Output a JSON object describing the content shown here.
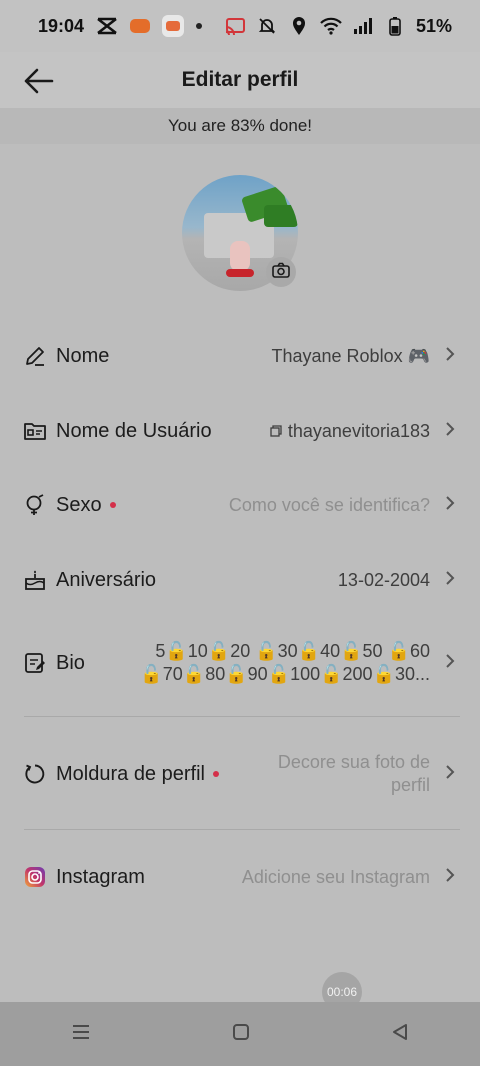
{
  "status_bar": {
    "time": "19:04",
    "battery": "51%",
    "icons": [
      "capcut-icon",
      "notification-app-icon",
      "game-app-icon",
      "dot-icon",
      "cast-icon",
      "mute-icon",
      "location-icon",
      "wifi-icon",
      "signal-icon",
      "battery-icon"
    ]
  },
  "header": {
    "title": "Editar perfil",
    "back_icon": "arrow-left-icon"
  },
  "progress_text": "You are 83% done!",
  "profile": {
    "camera_icon": "camera-icon"
  },
  "fields": [
    {
      "id": "nome",
      "icon": "pencil-icon",
      "label": "Nome",
      "value": "Thayane Roblox 🎮",
      "required": false,
      "placeholder": false
    },
    {
      "id": "usuario",
      "icon": "id-card-icon",
      "label": "Nome de Usuário",
      "value": "thayanevitoria183",
      "required": false,
      "placeholder": false
    },
    {
      "id": "sexo",
      "icon": "gender-icon",
      "label": "Sexo",
      "value": "Como você se identifica?",
      "required": true,
      "placeholder": true
    },
    {
      "id": "aniversario",
      "icon": "cake-icon",
      "label": "Aniversário",
      "value": "13-02-2004",
      "required": false,
      "placeholder": false
    },
    {
      "id": "bio",
      "icon": "bio-edit-icon",
      "label": "Bio",
      "value_line1": "5🔓10🔓20 🔓30🔓40🔓50 🔓60",
      "value_line2": "🔓70🔓80🔓90🔓100🔓200🔓30...",
      "required": false,
      "placeholder": false
    },
    {
      "id": "moldura",
      "icon": "frame-refresh-icon",
      "label": "Moldura de perfil",
      "value_line1": "Decore sua foto de",
      "value_line2": "perfil",
      "required": true,
      "placeholder": true
    },
    {
      "id": "instagram",
      "icon": "instagram-icon",
      "label": "Instagram",
      "value": "Adicione seu Instagram",
      "required": false,
      "placeholder": true
    }
  ],
  "timer": "00:06",
  "nav_bar": {
    "buttons": [
      "menu-icon",
      "home-square-icon",
      "back-triangle-icon"
    ]
  }
}
